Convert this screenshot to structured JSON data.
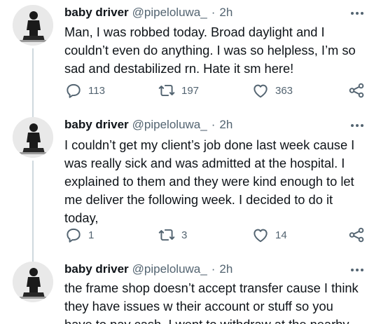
{
  "tweets": [
    {
      "name": "baby driver",
      "handle": "@pipeloluwa_",
      "separator": "·",
      "time": "2h",
      "lines": [
        "Man, I was robbed today. Broad daylight and I",
        "couldn’t even do anything. I was so helpless, I’m so",
        "sad and destabilized rn. Hate it sm here!"
      ],
      "replies": "113",
      "retweets": "197",
      "likes": "363"
    },
    {
      "name": "baby driver",
      "handle": "@pipeloluwa_",
      "separator": "·",
      "time": "2h",
      "lines": [
        "I couldn’t get my client’s job done last week cause I",
        "was really sick and was admitted at the hospital. I",
        "explained to them and they were kind enough to let",
        "me deliver the following week. I decided to do it",
        "today,"
      ],
      "replies": "1",
      "retweets": "3",
      "likes": "14"
    },
    {
      "name": "baby driver",
      "handle": "@pipeloluwa_",
      "separator": "·",
      "time": "2h",
      "lines": [
        "the frame shop doesn’t accept transfer cause I think",
        "they have issues w their account or stuff so you",
        "have to pay cash. I went to withdraw at the nearby"
      ]
    }
  ],
  "icons": {
    "reply": "reply-icon",
    "retweet": "retweet-icon",
    "like": "like-icon",
    "share": "share-icon",
    "more": "more-icon"
  },
  "colors": {
    "text": "#0f1419",
    "secondary": "#536471",
    "thread_line": "#cfd9de"
  }
}
